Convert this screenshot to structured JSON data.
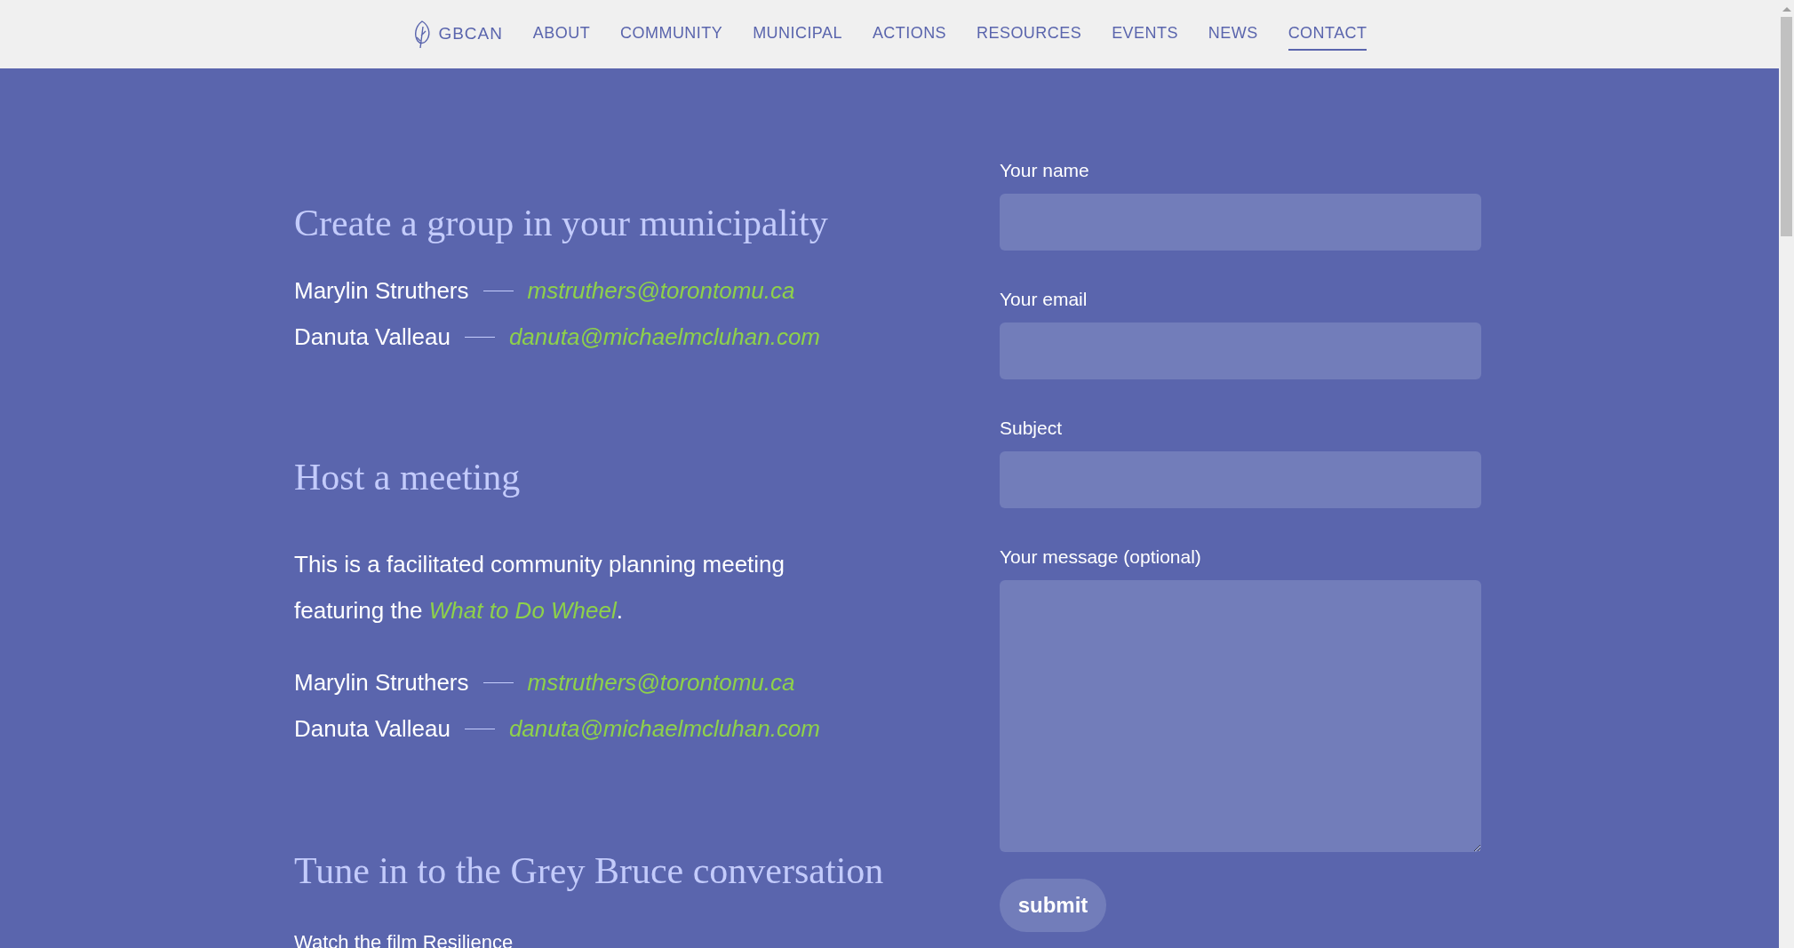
{
  "nav": {
    "brand": "GBCAN",
    "items": [
      {
        "label": "ABOUT",
        "selected": false
      },
      {
        "label": "COMMUNITY",
        "selected": false
      },
      {
        "label": "MUNICIPAL",
        "selected": false
      },
      {
        "label": "ACTIONS",
        "selected": false
      },
      {
        "label": "RESOURCES",
        "selected": false
      },
      {
        "label": "EVENTS",
        "selected": false
      },
      {
        "label": "NEWS",
        "selected": false
      },
      {
        "label": "CONTACT",
        "selected": true
      }
    ]
  },
  "sections": [
    {
      "heading": "Create a group in your municipality",
      "contacts": [
        {
          "name": "Marylin Struthers",
          "email": "mstruthers@torontomu.ca"
        },
        {
          "name": "Danuta Valleau",
          "email": "danuta@michaelmcluhan.com"
        }
      ]
    },
    {
      "heading": "Host a meeting",
      "paragraph": {
        "before": "This is a facilitated community planning meeting featuring the",
        "link": "What to Do Wheel",
        "after": "."
      },
      "contacts": [
        {
          "name": "Marylin Struthers",
          "email": "mstruthers@torontomu.ca"
        },
        {
          "name": "Danuta Valleau",
          "email": "danuta@michaelmcluhan.com"
        }
      ]
    },
    {
      "heading": "Tune in to the Grey Bruce conversation",
      "text": "Watch the film Resilience"
    }
  ],
  "form": {
    "fields": [
      {
        "kind": "input",
        "label": "Your name"
      },
      {
        "kind": "input",
        "label": "Your email"
      },
      {
        "kind": "input",
        "label": "Subject"
      },
      {
        "kind": "textarea",
        "label": "Your message (optional)"
      }
    ],
    "submit": "submit"
  }
}
